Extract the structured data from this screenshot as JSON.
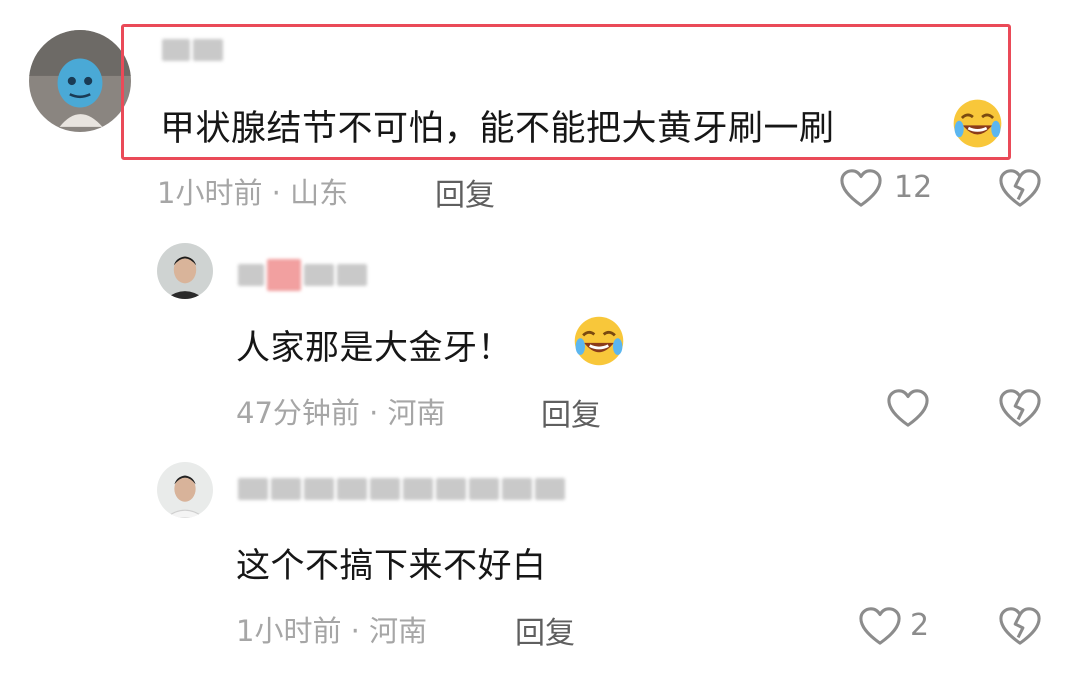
{
  "comments": [
    {
      "text": "甲状腺结节不可怕，能不能把大黄牙刷一刷",
      "emoji": "rolling-on-floor-laughing",
      "time_location": "1小时前 · 山东",
      "reply_label": "回复",
      "like_count": "12"
    },
    {
      "text": "人家那是大金牙！",
      "emoji": "rolling-on-floor-laughing",
      "time_location": "47分钟前 · 河南",
      "reply_label": "回复",
      "like_count": ""
    },
    {
      "text": "这个不搞下来不好白",
      "time_location": "1小时前 · 河南",
      "reply_label": "回复",
      "like_count": "2"
    }
  ],
  "colors": {
    "highlight_border": "#ea4a58",
    "meta_text": "#a6a6a6",
    "reply_text": "#5f5f5f"
  }
}
